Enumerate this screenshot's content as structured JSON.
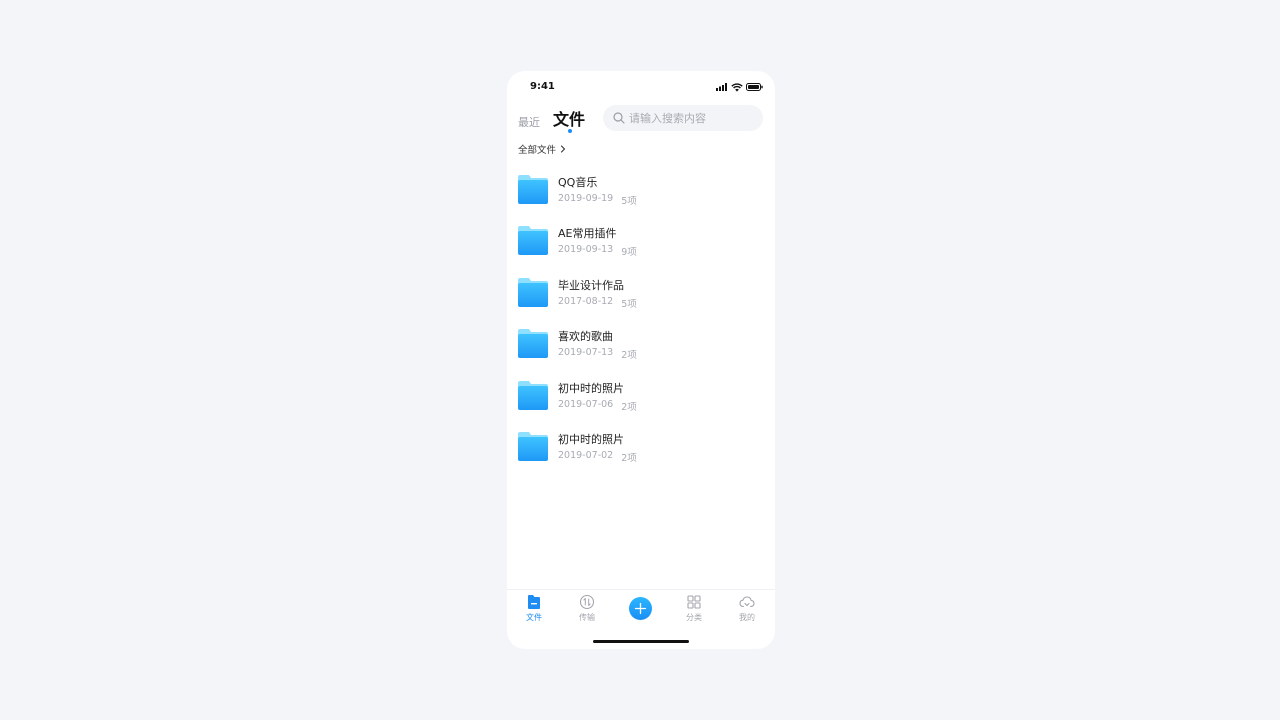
{
  "status_bar": {
    "time": "9:41",
    "icons": [
      "signal-icon",
      "wifi-icon",
      "battery-icon"
    ]
  },
  "header": {
    "tab_recent": "最近",
    "tab_files": "文件",
    "search": {
      "placeholder": "请输入搜索内容",
      "value": ""
    }
  },
  "breadcrumb": {
    "label": "全部文件",
    "icon": "chevron-right-icon"
  },
  "files": [
    {
      "name": "QQ音乐",
      "date": "2019-09-19",
      "count": "5项"
    },
    {
      "name": "AE常用插件",
      "date": "2019-09-13",
      "count": "9项"
    },
    {
      "name": "毕业设计作品",
      "date": "2017-08-12",
      "count": "5项"
    },
    {
      "name": "喜欢的歌曲",
      "date": "2019-07-13",
      "count": "2项"
    },
    {
      "name": "初中时的照片",
      "date": "2019-07-06",
      "count": "2项"
    },
    {
      "name": "初中时的照片",
      "date": "2019-07-02",
      "count": "2项"
    }
  ],
  "tab_bar": {
    "items": [
      {
        "label": "文件",
        "icon": "file-icon",
        "active": true
      },
      {
        "label": "传输",
        "icon": "transfer-icon",
        "active": false
      },
      {
        "label": "分类",
        "icon": "grid-icon",
        "active": false
      },
      {
        "label": "我的",
        "icon": "cloud-download-icon",
        "active": false
      }
    ],
    "add_icon": "plus-icon"
  },
  "colors": {
    "accent": "#1f8cf2",
    "folder_light": "#7fdcff",
    "folder_dark": "#1f9cf7",
    "inactive": "#a3a6ad",
    "background": "#f4f5f9"
  }
}
